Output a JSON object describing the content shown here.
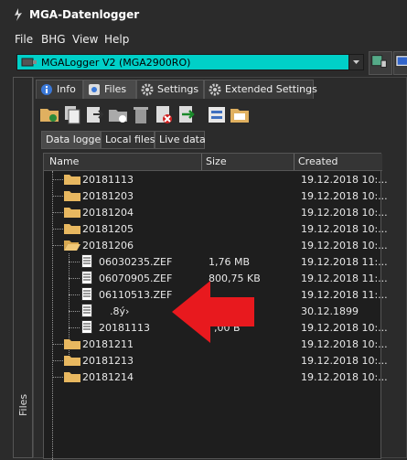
{
  "window": {
    "title": "MGA-Datenlogger"
  },
  "menu": [
    "File",
    "BHG",
    "View",
    "Help"
  ],
  "device": {
    "selected": "MGALogger V2 (MGA2900RO)"
  },
  "sidebar": {
    "label": "Files"
  },
  "tabs": [
    {
      "label": "Info",
      "icon": "info-icon"
    },
    {
      "label": "Files",
      "icon": "files-icon",
      "active": true
    },
    {
      "label": "Settings",
      "icon": "gear-icon"
    },
    {
      "label": "Extended Settings",
      "icon": "gear-icon"
    }
  ],
  "subtabs": [
    "Data logger",
    "Local files",
    "Live data"
  ],
  "table": {
    "columns": [
      "Name",
      "Size",
      "Created"
    ],
    "rows": [
      {
        "name": "20181113",
        "size": "",
        "created": "19.12.2018 10:..."
      },
      {
        "name": "20181203",
        "size": "",
        "created": "19.12.2018 10:..."
      },
      {
        "name": "20181204",
        "size": "",
        "created": "19.12.2018 10:..."
      },
      {
        "name": "20181205",
        "size": "",
        "created": "19.12.2018 10:..."
      },
      {
        "name": "20181206",
        "size": "",
        "created": "19.12.2018 10:..."
      },
      {
        "name": "06030235.ZEF",
        "size": "1,76 MB",
        "created": "19.12.2018 11:..."
      },
      {
        "name": "06070905.ZEF",
        "size": "800,75 KB",
        "created": "19.12.2018 11:..."
      },
      {
        "name": "06110513.ZEF",
        "size": "",
        "created": "19.12.2018 11:..."
      },
      {
        "name": ".8ý›",
        "size": "",
        "created": "30.12.1899"
      },
      {
        "name": "20181113",
        "size": ",00 B",
        "created": "19.12.2018 10:..."
      },
      {
        "name": "20181211",
        "size": "",
        "created": "19.12.2018 10:..."
      },
      {
        "name": "20181213",
        "size": "",
        "created": "19.12.2018 10:..."
      },
      {
        "name": "20181214",
        "size": "",
        "created": "19.12.2018 10:..."
      }
    ]
  },
  "colors": {
    "accent": "#00d0c8",
    "arrow": "#e8191e"
  }
}
